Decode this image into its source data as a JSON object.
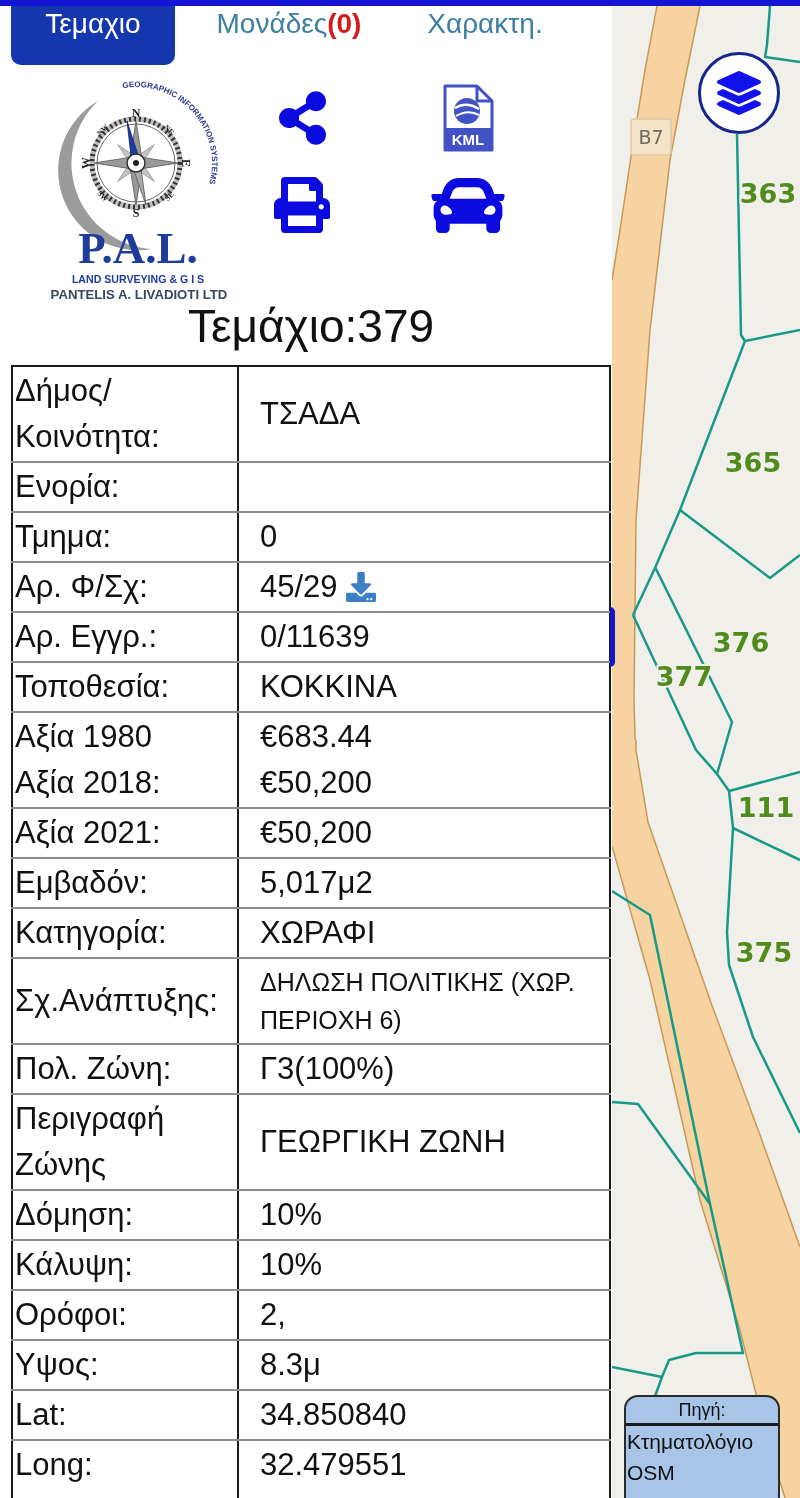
{
  "tabs": [
    {
      "label": "Τεμαχιο",
      "selected": true
    },
    {
      "label": "Μονάδες",
      "count": "(0)",
      "selected": false
    },
    {
      "label": "Χαρακτη.",
      "selected": false
    }
  ],
  "logo": {
    "arc_text": "GEOGRAPHIC INFORMATION SYSTEMS",
    "compass_labels": [
      "N",
      "NE",
      "E",
      "SE",
      "S",
      "SW",
      "W",
      "NW"
    ],
    "initials": "P.A.L.",
    "tagline": "LAND SURVEYING & G I S",
    "company": "PANTELIS A. LIVADIOTI LTD"
  },
  "toolbar": [
    {
      "kind": "share"
    },
    {
      "kind": "kml",
      "label": "KML"
    },
    {
      "kind": "print"
    },
    {
      "kind": "car"
    }
  ],
  "title": "Τεμάχιο:379",
  "table": {
    "rows": [
      {
        "kind": "plain",
        "label": "Δήμος/Κοινότητα:",
        "value": "ΤΣΑΔΑ"
      },
      {
        "kind": "plain",
        "label": "Ενορία:"
      },
      {
        "kind": "plain",
        "label": "Τμημα:",
        "value": "0"
      },
      {
        "kind": "download",
        "label": "Αρ. Φ/Σχ:",
        "value": "45/29"
      },
      {
        "kind": "plain",
        "label": "Αρ. Εγγρ.:",
        "value": "0/11639"
      },
      {
        "kind": "plain",
        "label": "Τοποθεσία:",
        "value": "ΚΟΚΚΙΝΑ"
      },
      {
        "kind": "pair",
        "lines": [
          {
            "label": "Αξία 1980",
            "value": "€683.44"
          },
          {
            "label": "Αξία 2018:",
            "value": "€50,200"
          }
        ]
      },
      {
        "kind": "plain",
        "label": "Αξία 2021:",
        "value": "€50,200"
      },
      {
        "kind": "plain",
        "label": "Εμβαδόν:",
        "value": "5,017μ2"
      },
      {
        "kind": "plain",
        "label": "Κατηγορία:",
        "value": "ΧΩΡΑΦΙ"
      },
      {
        "kind": "compact",
        "label": "Σχ.Ανάπτυξης:",
        "value": "ΔΗΛΩΣΗ ΠΟΛΙΤΙΚΗΣ (ΧΩΡ. ΠΕΡΙΟΧΗ 6)"
      },
      {
        "kind": "plain",
        "label": "Πολ. Ζώνη:",
        "value": "Γ3(100%)"
      },
      {
        "kind": "plain",
        "label": "Περιγραφή Ζώνης",
        "value": "ΓΕΩΡΓΙΚΗ ΖΩΝΗ"
      },
      {
        "kind": "plain",
        "label": "Δόμηση:",
        "value": "10%"
      },
      {
        "kind": "plain",
        "label": "Κάλυψη:",
        "value": "10%"
      },
      {
        "kind": "plain",
        "label": "Ορόφοι:",
        "value": "2,"
      },
      {
        "kind": "plain",
        "label": "Υψος:",
        "value": "8.3μ"
      },
      {
        "kind": "plain",
        "label": "Lat:",
        "value": "34.850840"
      },
      {
        "kind": "plain",
        "label": "Long:",
        "value": "32.479551"
      }
    ]
  },
  "map": {
    "road_label": "B7",
    "parcels": [
      "363",
      "365",
      "376",
      "377",
      "111",
      "375"
    ],
    "source": {
      "title": "Πηγή:",
      "items": [
        "Κτηματολόγιο",
        "OSM"
      ]
    }
  }
}
